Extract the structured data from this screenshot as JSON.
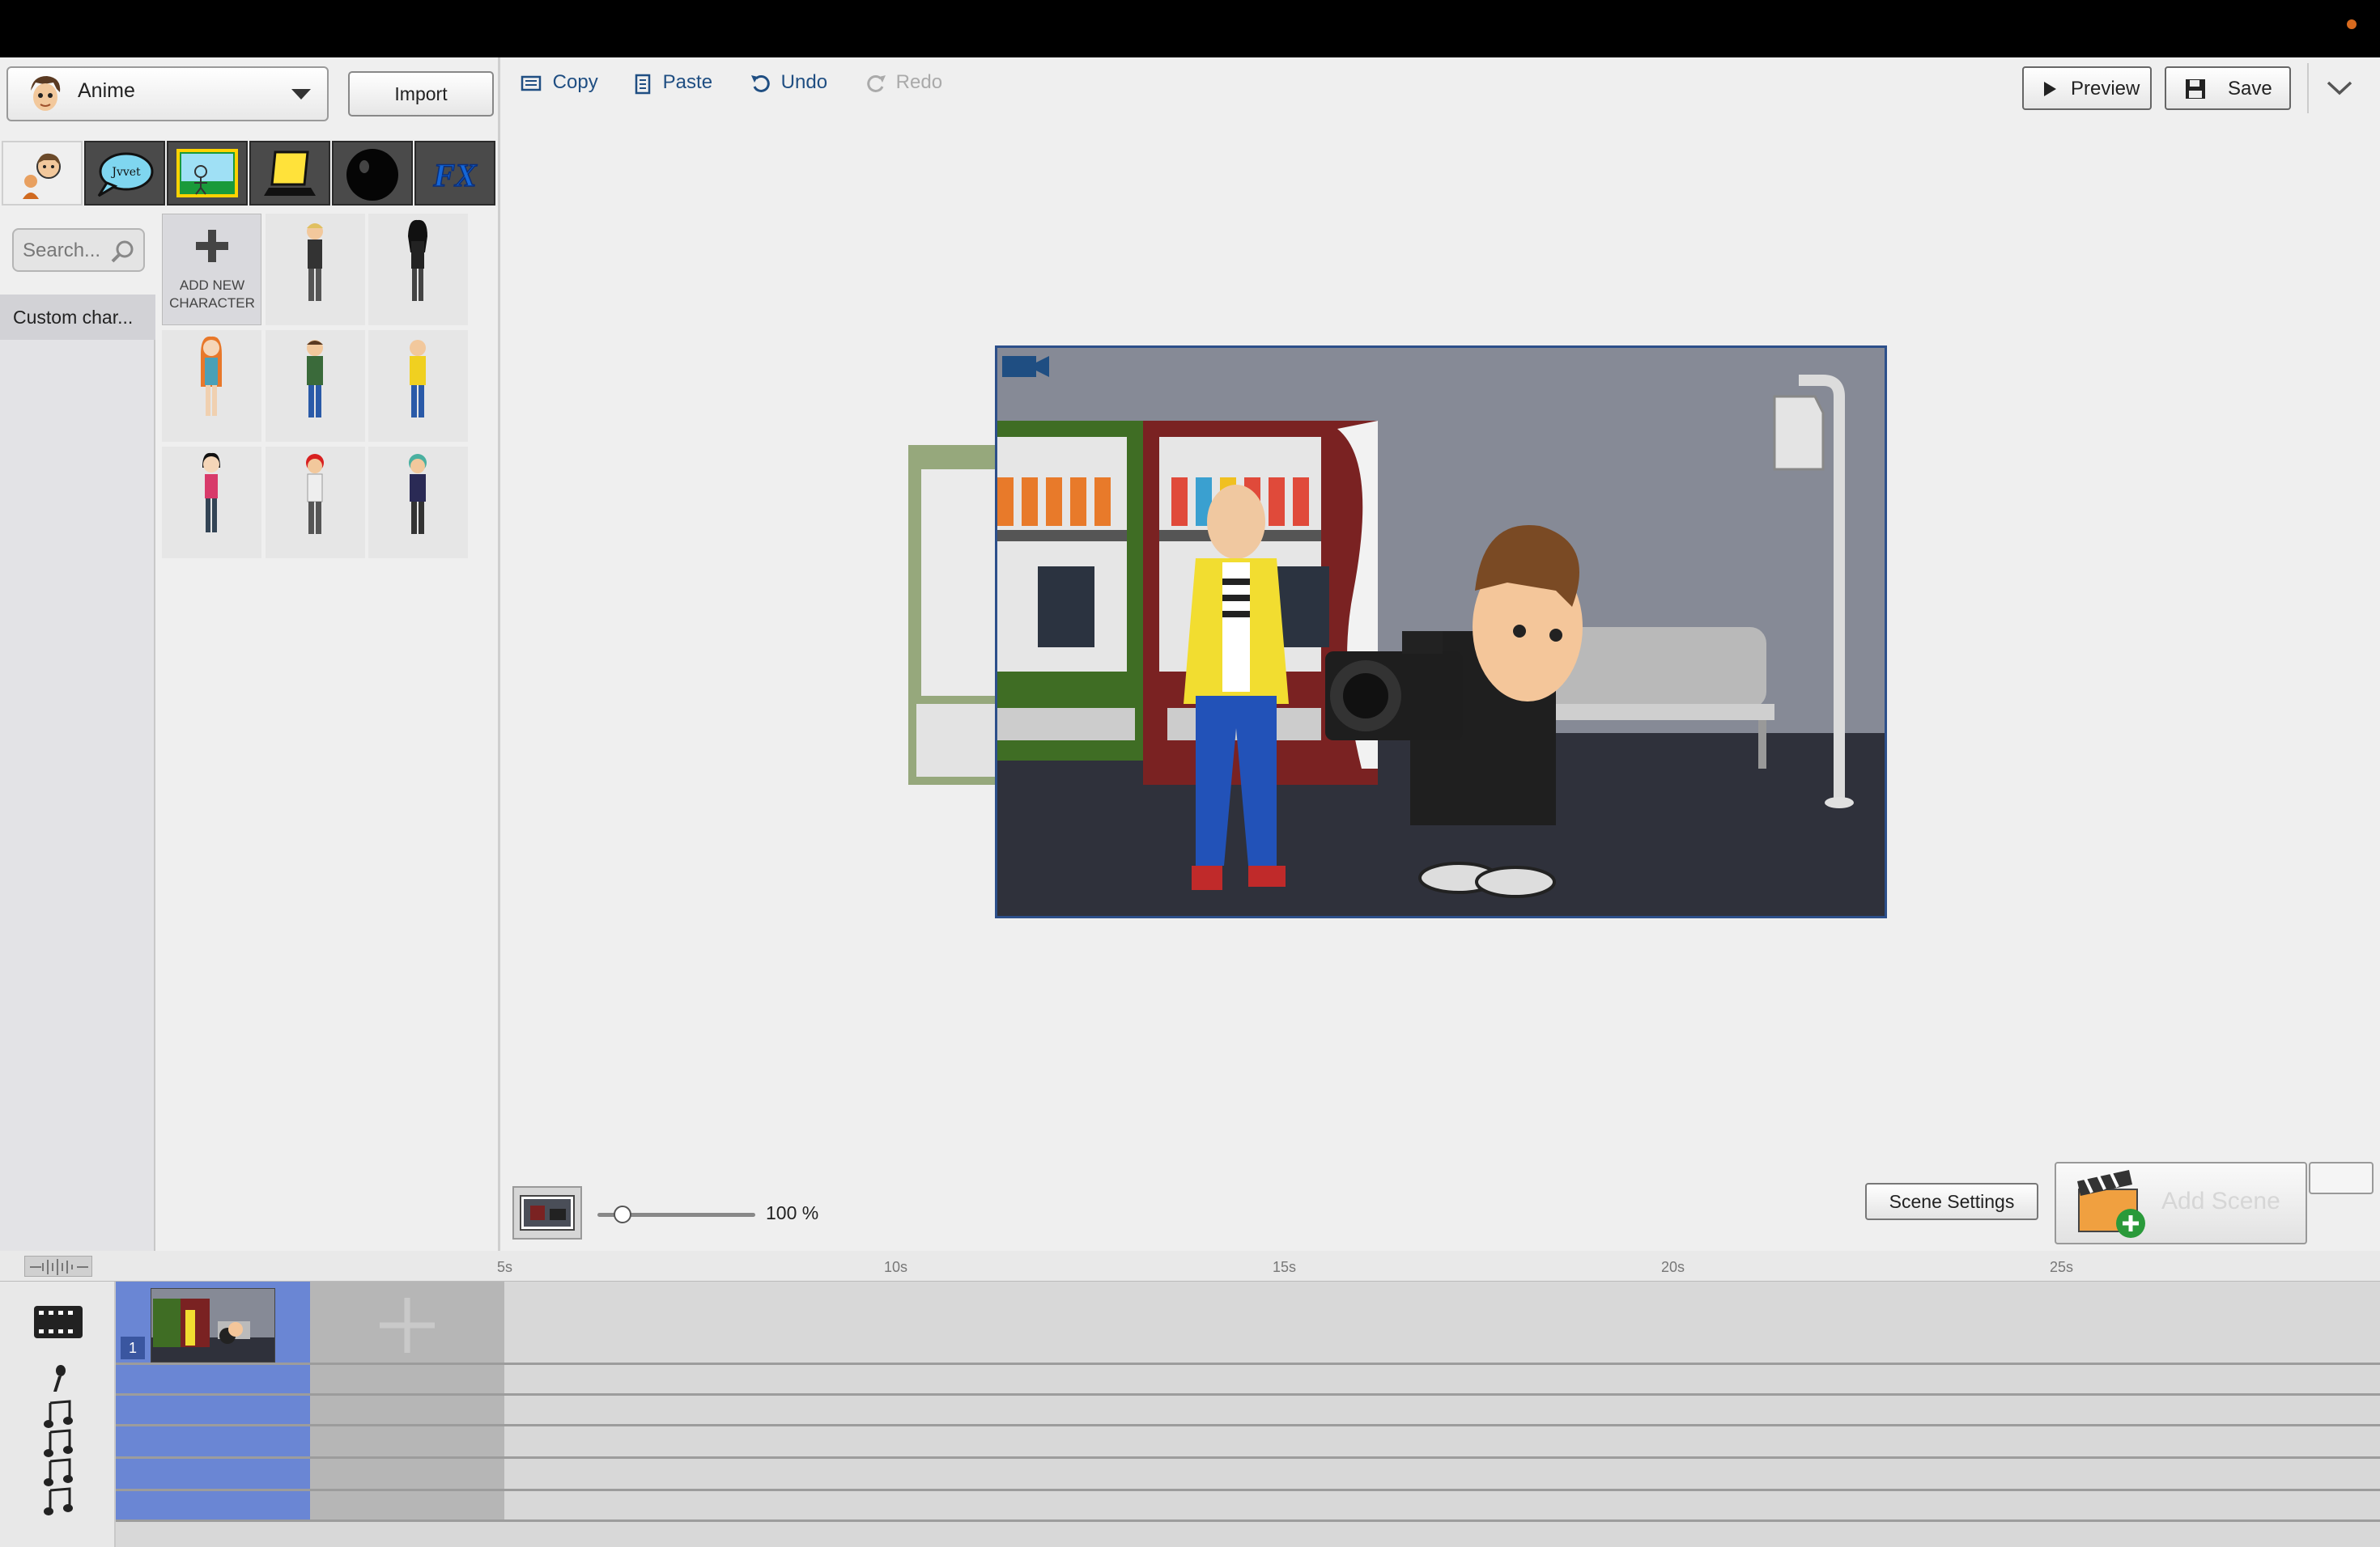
{
  "window": {
    "top_bar": "",
    "accent": "#d86a1e"
  },
  "sidebar": {
    "theme": {
      "label": "Anime",
      "icon": "character-face-icon"
    },
    "import_label": "Import",
    "category_tabs": [
      {
        "name": "characters",
        "icon": "characters-icon",
        "active": true
      },
      {
        "name": "dialogue",
        "icon": "speech-bubble-icon",
        "bubble_text": "Jvvet"
      },
      {
        "name": "backgrounds",
        "icon": "background-icon"
      },
      {
        "name": "props",
        "icon": "props-icon"
      },
      {
        "name": "shapes",
        "icon": "shape-icon"
      },
      {
        "name": "effects",
        "icon": "fx-icon",
        "text": "FX"
      }
    ],
    "search": {
      "placeholder": "Search..."
    },
    "category": {
      "label": "Custom char..."
    },
    "add_new": {
      "line1": "ADD NEW",
      "line2": "CHARACTER"
    },
    "characters": [
      "blond-guy",
      "dark-hair-girl",
      "orange-hair-girl",
      "green-jacket-guy",
      "yellow-jacket-guy",
      "pink-top-girl",
      "red-hair-guy",
      "teal-hair-guy"
    ]
  },
  "toolbar": {
    "copy": "Copy",
    "paste": "Paste",
    "undo": "Undo",
    "redo": "Redo",
    "preview": "Preview",
    "save": "Save"
  },
  "stage": {
    "zoom": "100 %",
    "scene_settings": "Scene Settings",
    "add_scene": "Add Scene"
  },
  "timeline": {
    "ticks": [
      "5s",
      "10s",
      "15s",
      "20s",
      "25s"
    ],
    "scene_number": "1",
    "colors": {
      "scene": "#6a86d4",
      "add": "#b6b6b6"
    }
  }
}
